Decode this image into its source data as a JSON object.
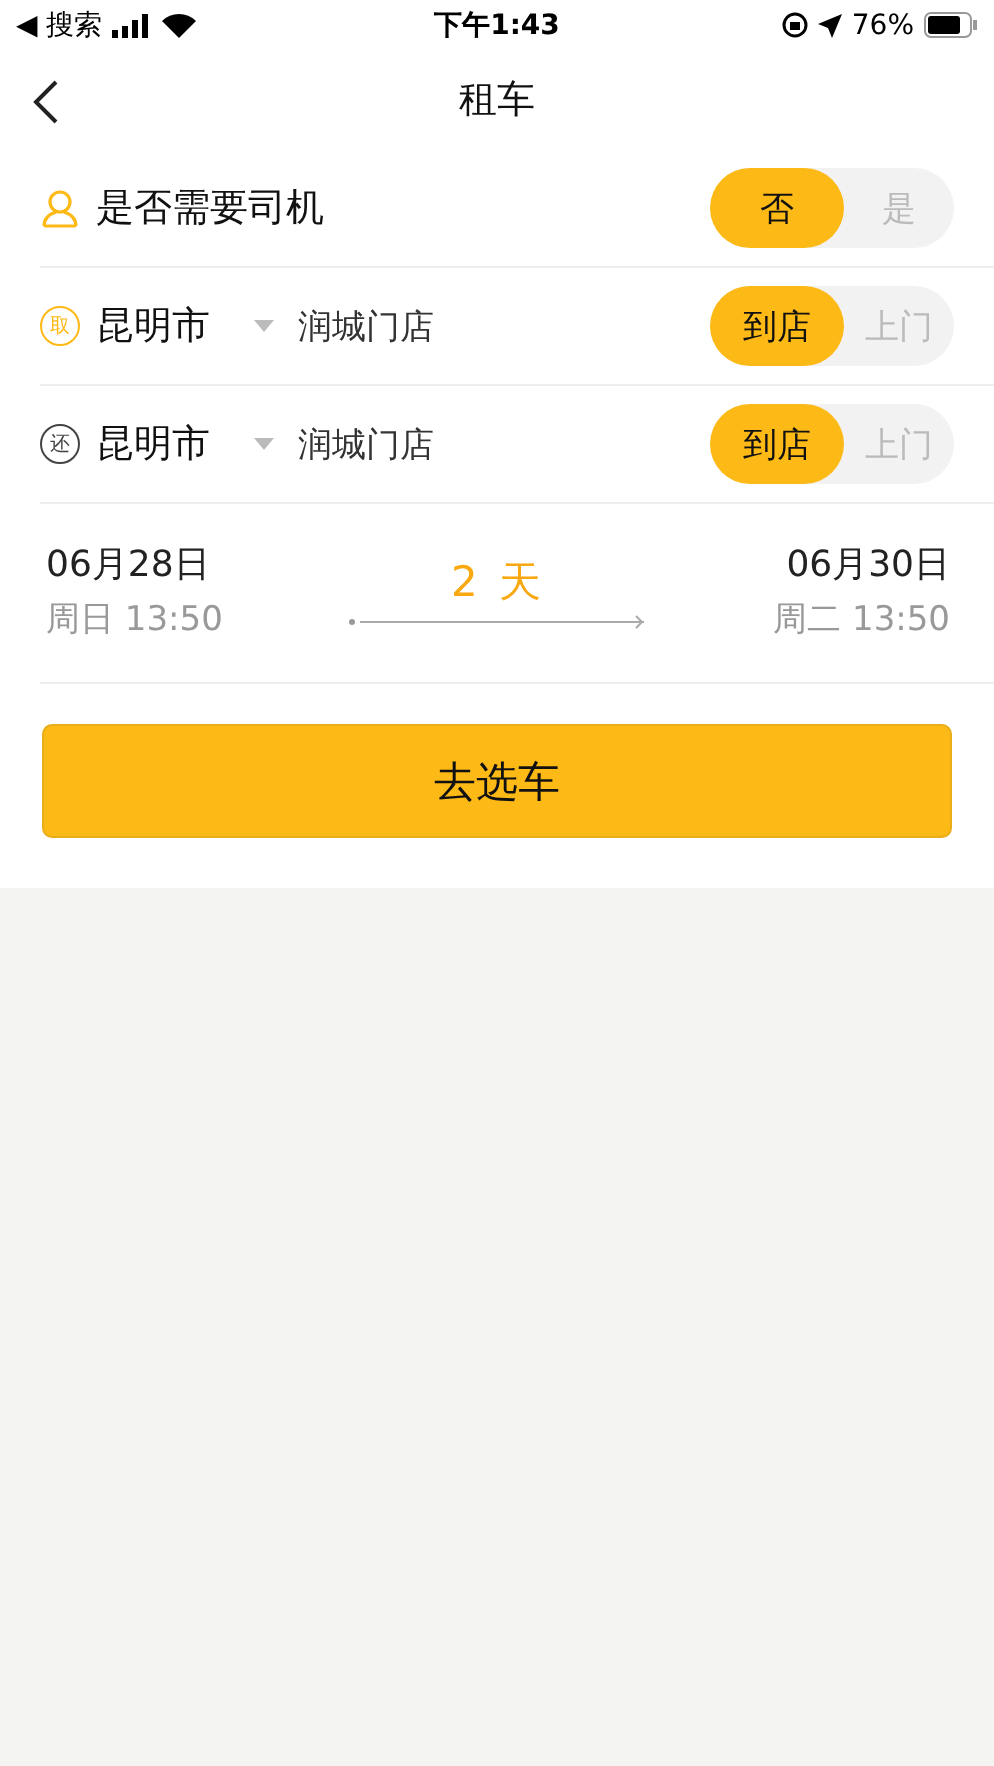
{
  "status_bar": {
    "back_label": "◀ 搜索",
    "time": "下午1:43",
    "battery": "76%"
  },
  "nav": {
    "title": "租车"
  },
  "driver": {
    "label": "是否需要司机",
    "options": [
      {
        "label": "否",
        "selected": true
      },
      {
        "label": "是",
        "selected": false
      }
    ]
  },
  "locations": [
    {
      "badge": "取",
      "kind": "pickup",
      "city": "昆明市",
      "store": "润城门店",
      "options": [
        {
          "label": "到店",
          "selected": true
        },
        {
          "label": "上门",
          "selected": false
        }
      ]
    },
    {
      "badge": "还",
      "kind": "return",
      "city": "昆明市",
      "store": "润城门店",
      "options": [
        {
          "label": "到店",
          "selected": true
        },
        {
          "label": "上门",
          "selected": false
        }
      ]
    }
  ],
  "dates": {
    "start": {
      "date": "06月28日",
      "time": "周日 13:50"
    },
    "duration": "2 天",
    "end": {
      "date": "06月30日",
      "time": "周二 13:50"
    }
  },
  "submit": "去选车"
}
